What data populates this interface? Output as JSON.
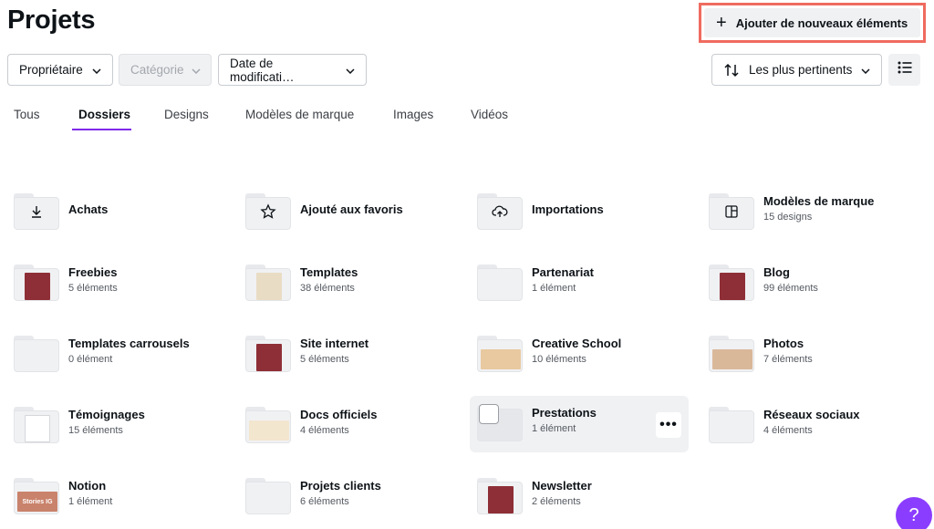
{
  "header": {
    "title": "Projets",
    "add_button_label": "Ajouter de nouveaux éléments"
  },
  "filters": {
    "owner": "Propriétaire",
    "category": "Catégorie",
    "date": "Date de modificati…",
    "sort": "Les plus pertinents"
  },
  "tabs": [
    {
      "label": "Tous"
    },
    {
      "label": "Dossiers"
    },
    {
      "label": "Designs"
    },
    {
      "label": "Modèles de marque"
    },
    {
      "label": "Images"
    },
    {
      "label": "Vidéos"
    }
  ],
  "folders": [
    {
      "name": "Achats",
      "count": "",
      "icon": "download-icon"
    },
    {
      "name": "Ajouté aux favoris",
      "count": "",
      "icon": "star-icon"
    },
    {
      "name": "Importations",
      "count": "",
      "icon": "cloud-upload-icon"
    },
    {
      "name": "Modèles de marque",
      "count": "15 designs",
      "icon": "brand-template-icon"
    },
    {
      "name": "Freebies",
      "count": "5 éléments",
      "preview": "#8e2f37"
    },
    {
      "name": "Templates",
      "count": "38 éléments",
      "preview": "#e9dcc4"
    },
    {
      "name": "Partenariat",
      "count": "1 élément"
    },
    {
      "name": "Blog",
      "count": "99 éléments",
      "preview": "#8e2f37"
    },
    {
      "name": "Templates carrousels",
      "count": "0 élément"
    },
    {
      "name": "Site internet",
      "count": "5 éléments",
      "preview": "#8e2f37"
    },
    {
      "name": "Creative School",
      "count": "10 éléments",
      "preview": "#e8c9a0"
    },
    {
      "name": "Photos",
      "count": "7 éléments",
      "preview": "#d9b89a"
    },
    {
      "name": "Témoignages",
      "count": "15 éléments",
      "preview": "#ffffff"
    },
    {
      "name": "Docs officiels",
      "count": "4 éléments",
      "preview": "#f3e6cf"
    },
    {
      "name": "Prestations",
      "count": "1 élément"
    },
    {
      "name": "Réseaux sociaux",
      "count": "4 éléments"
    },
    {
      "name": "Notion",
      "count": "1 élément",
      "preview": "#c9826b",
      "preview_text": "Stories IG"
    },
    {
      "name": "Projets clients",
      "count": "6 éléments"
    },
    {
      "name": "Newsletter",
      "count": "2 éléments",
      "preview": "#8e2f37"
    }
  ],
  "colors": {
    "accent": "#7d2ae8",
    "help": "#8b3dff",
    "highlight_border": "#ef6b5f"
  }
}
